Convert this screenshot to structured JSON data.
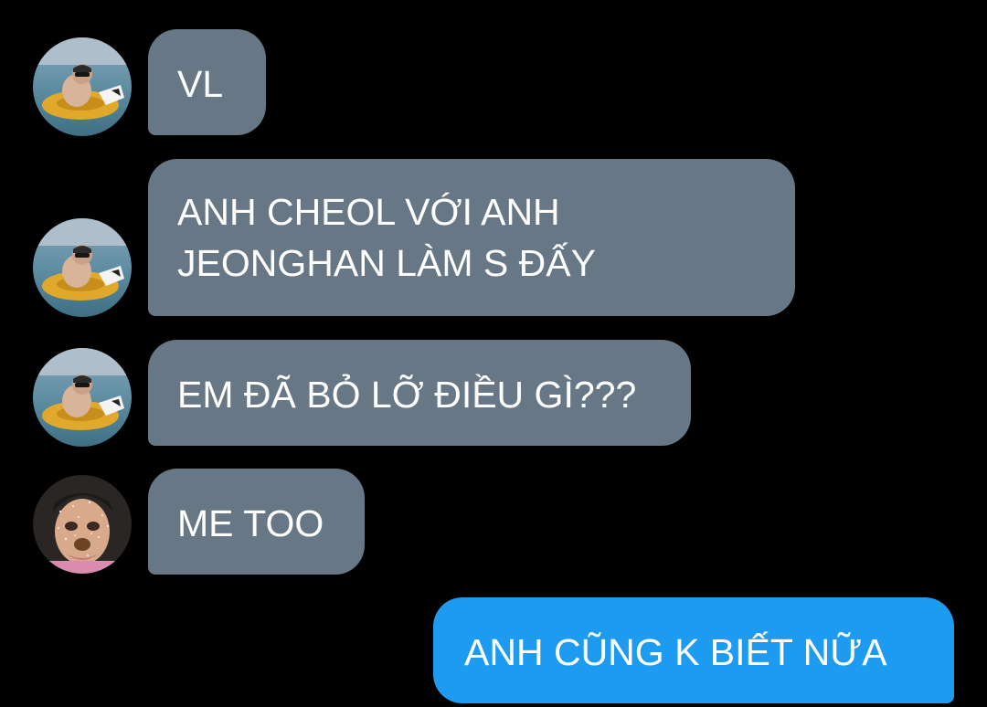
{
  "colors": {
    "background": "#000000",
    "incoming_bubble": "#677785",
    "outgoing_bubble": "#1d9bf0",
    "text": "#ffffff"
  },
  "messages": [
    {
      "direction": "incoming",
      "avatar": "avatar-photo-float-ring",
      "text": "VL"
    },
    {
      "direction": "incoming",
      "avatar": "avatar-photo-float-ring",
      "lines": [
        "ANH CHEOL VỚI ANH",
        "JEONGHAN LÀM S ĐẤY"
      ]
    },
    {
      "direction": "incoming",
      "avatar": "avatar-photo-float-ring",
      "text": "EM ĐÃ BỎ LỠ ĐIỀU GÌ???"
    },
    {
      "direction": "incoming",
      "avatar": "avatar-photo-face-filter",
      "text": "ME TOO"
    },
    {
      "direction": "outgoing",
      "text": "ANH CŨNG K BIẾT NỮA"
    }
  ]
}
